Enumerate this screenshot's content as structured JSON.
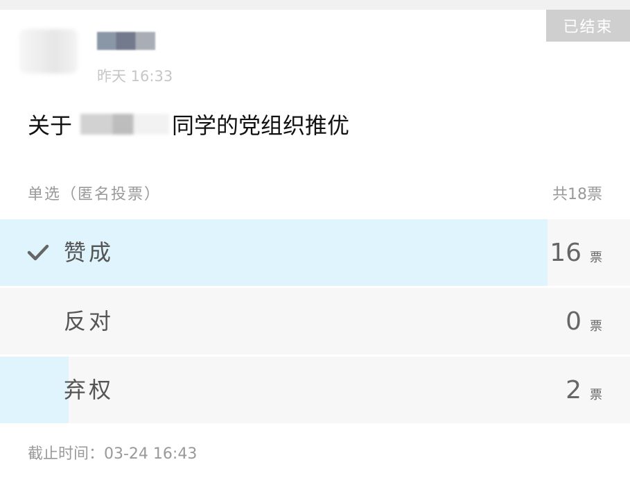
{
  "status_badge": "已结束",
  "post": {
    "time": "昨天 16:33"
  },
  "poll": {
    "title_prefix": "关于",
    "title_suffix": "同学的党组织推优",
    "type": "单选（匿名投票）",
    "total": "共18票",
    "total_votes": 18,
    "vote_unit": "票",
    "options": [
      {
        "label": "赞成",
        "count": "16",
        "votes": 16,
        "selected": true
      },
      {
        "label": "反对",
        "count": "0",
        "votes": 0,
        "selected": false
      },
      {
        "label": "弃权",
        "count": "2",
        "votes": 2,
        "selected": false
      }
    ],
    "deadline": "截止时间：03-24 16:43"
  },
  "colors": {
    "result_bar": "#e0f4fd",
    "row_background": "#f7f7f7",
    "badge_background": "#cfcfcf"
  },
  "icons": {
    "selected_option": "check-icon"
  }
}
